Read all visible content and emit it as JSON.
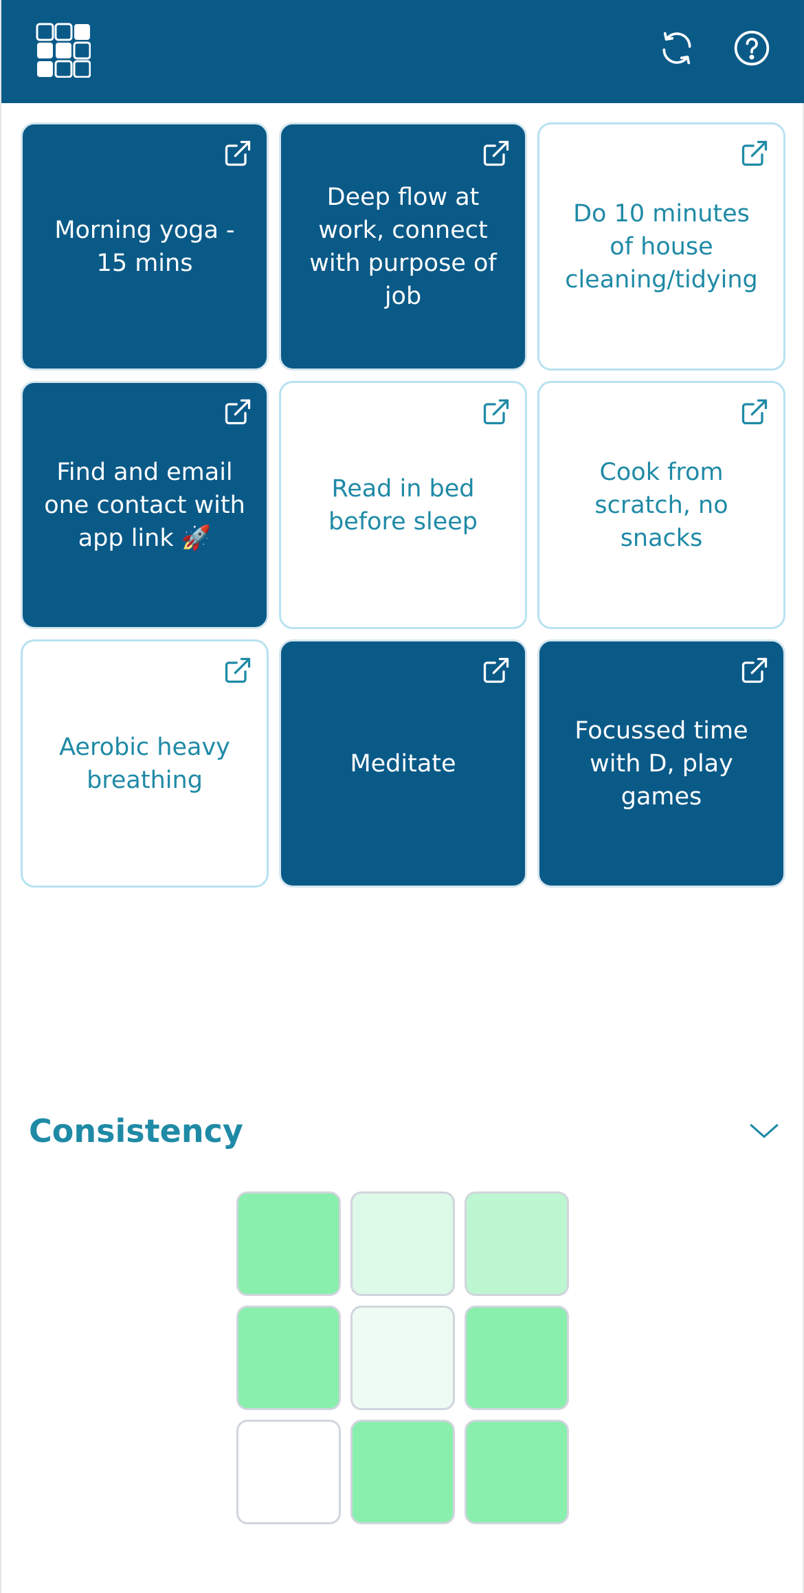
{
  "header": {
    "background": "#0a5a88",
    "logo_icon": "grid-logo-icon",
    "refresh_icon": "refresh-icon",
    "help_icon": "help-circle-icon"
  },
  "habits": [
    {
      "label": "Morning yoga - 15 mins",
      "done": true
    },
    {
      "label": "Deep flow at work, connect with purpose of job",
      "done": true
    },
    {
      "label": "Do 10 minutes of house cleaning/tidying",
      "done": false
    },
    {
      "label": "Find and email one contact with app link 🚀",
      "done": true
    },
    {
      "label": "Read in bed before sleep",
      "done": false
    },
    {
      "label": "Cook from scratch, no snacks",
      "done": false
    },
    {
      "label": "Aerobic heavy breathing",
      "done": false
    },
    {
      "label": "Meditate",
      "done": true
    },
    {
      "label": "Focussed time with D, play games",
      "done": true
    }
  ],
  "colors": {
    "done_tile": "#0a5a88",
    "open_tile_text": "#1f8aa6",
    "accent": "#1f8aa6"
  },
  "consistency": {
    "title": "Consistency",
    "toggle_icon": "chevron-down-icon",
    "cells": [
      "#88efac",
      "#ddf9e7",
      "#bcf7d1",
      "#88efac",
      "#eefbf2",
      "#88efac",
      "#ffffff",
      "#88efac",
      "#88efac"
    ]
  }
}
